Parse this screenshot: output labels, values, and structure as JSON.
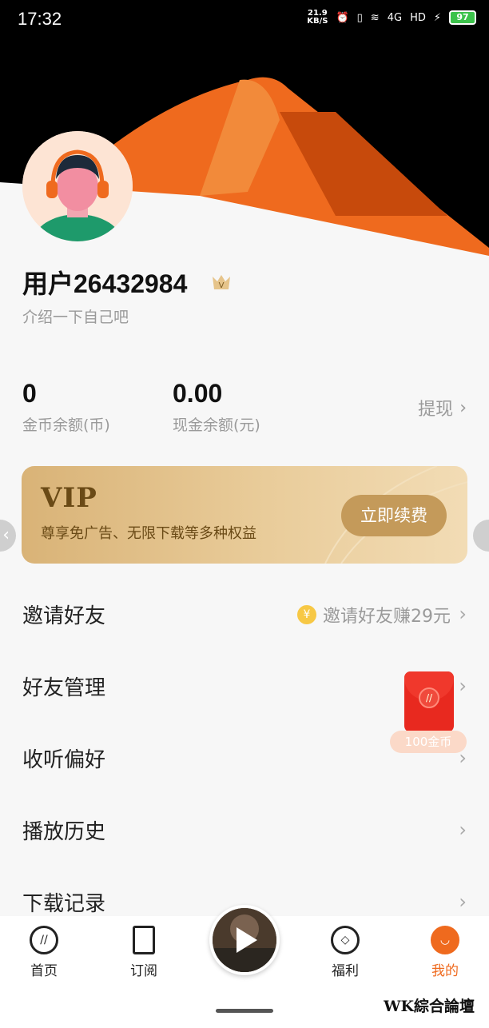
{
  "status_bar": {
    "time": "17:32",
    "speed": "21.9",
    "speed_unit": "KB/S",
    "network": "4G",
    "battery": "97"
  },
  "profile": {
    "username": "用户26432984",
    "intro": "介绍一下自己吧",
    "vip_mark": "V"
  },
  "stats": [
    {
      "value": "0",
      "label": "金币余额(币)"
    },
    {
      "value": "0.00",
      "label": "现金余额(元)"
    }
  ],
  "withdraw_label": "提现",
  "vip_card": {
    "title": "VIP",
    "desc": "尊享免广告、无限下载等多种权益",
    "button": "立即续费"
  },
  "menu": [
    {
      "label": "邀请好友",
      "hint": "邀请好友赚29元",
      "coin": "¥"
    },
    {
      "label": "好友管理"
    },
    {
      "label": "收听偏好"
    },
    {
      "label": "播放历史"
    },
    {
      "label": "下载记录"
    }
  ],
  "red_packet": {
    "badge": "100金币"
  },
  "tabs": [
    {
      "label": "首页",
      "icon": "home-icon"
    },
    {
      "label": "订阅",
      "icon": "bookmark-icon"
    },
    {
      "label": "福利",
      "icon": "welfare-icon"
    },
    {
      "label": "我的",
      "icon": "profile-icon"
    }
  ],
  "watermark": "WK綜合論壇",
  "colors": {
    "accent": "#ef6a1e",
    "vip_button": "#c49a5a",
    "red_packet": "#e8291f"
  }
}
